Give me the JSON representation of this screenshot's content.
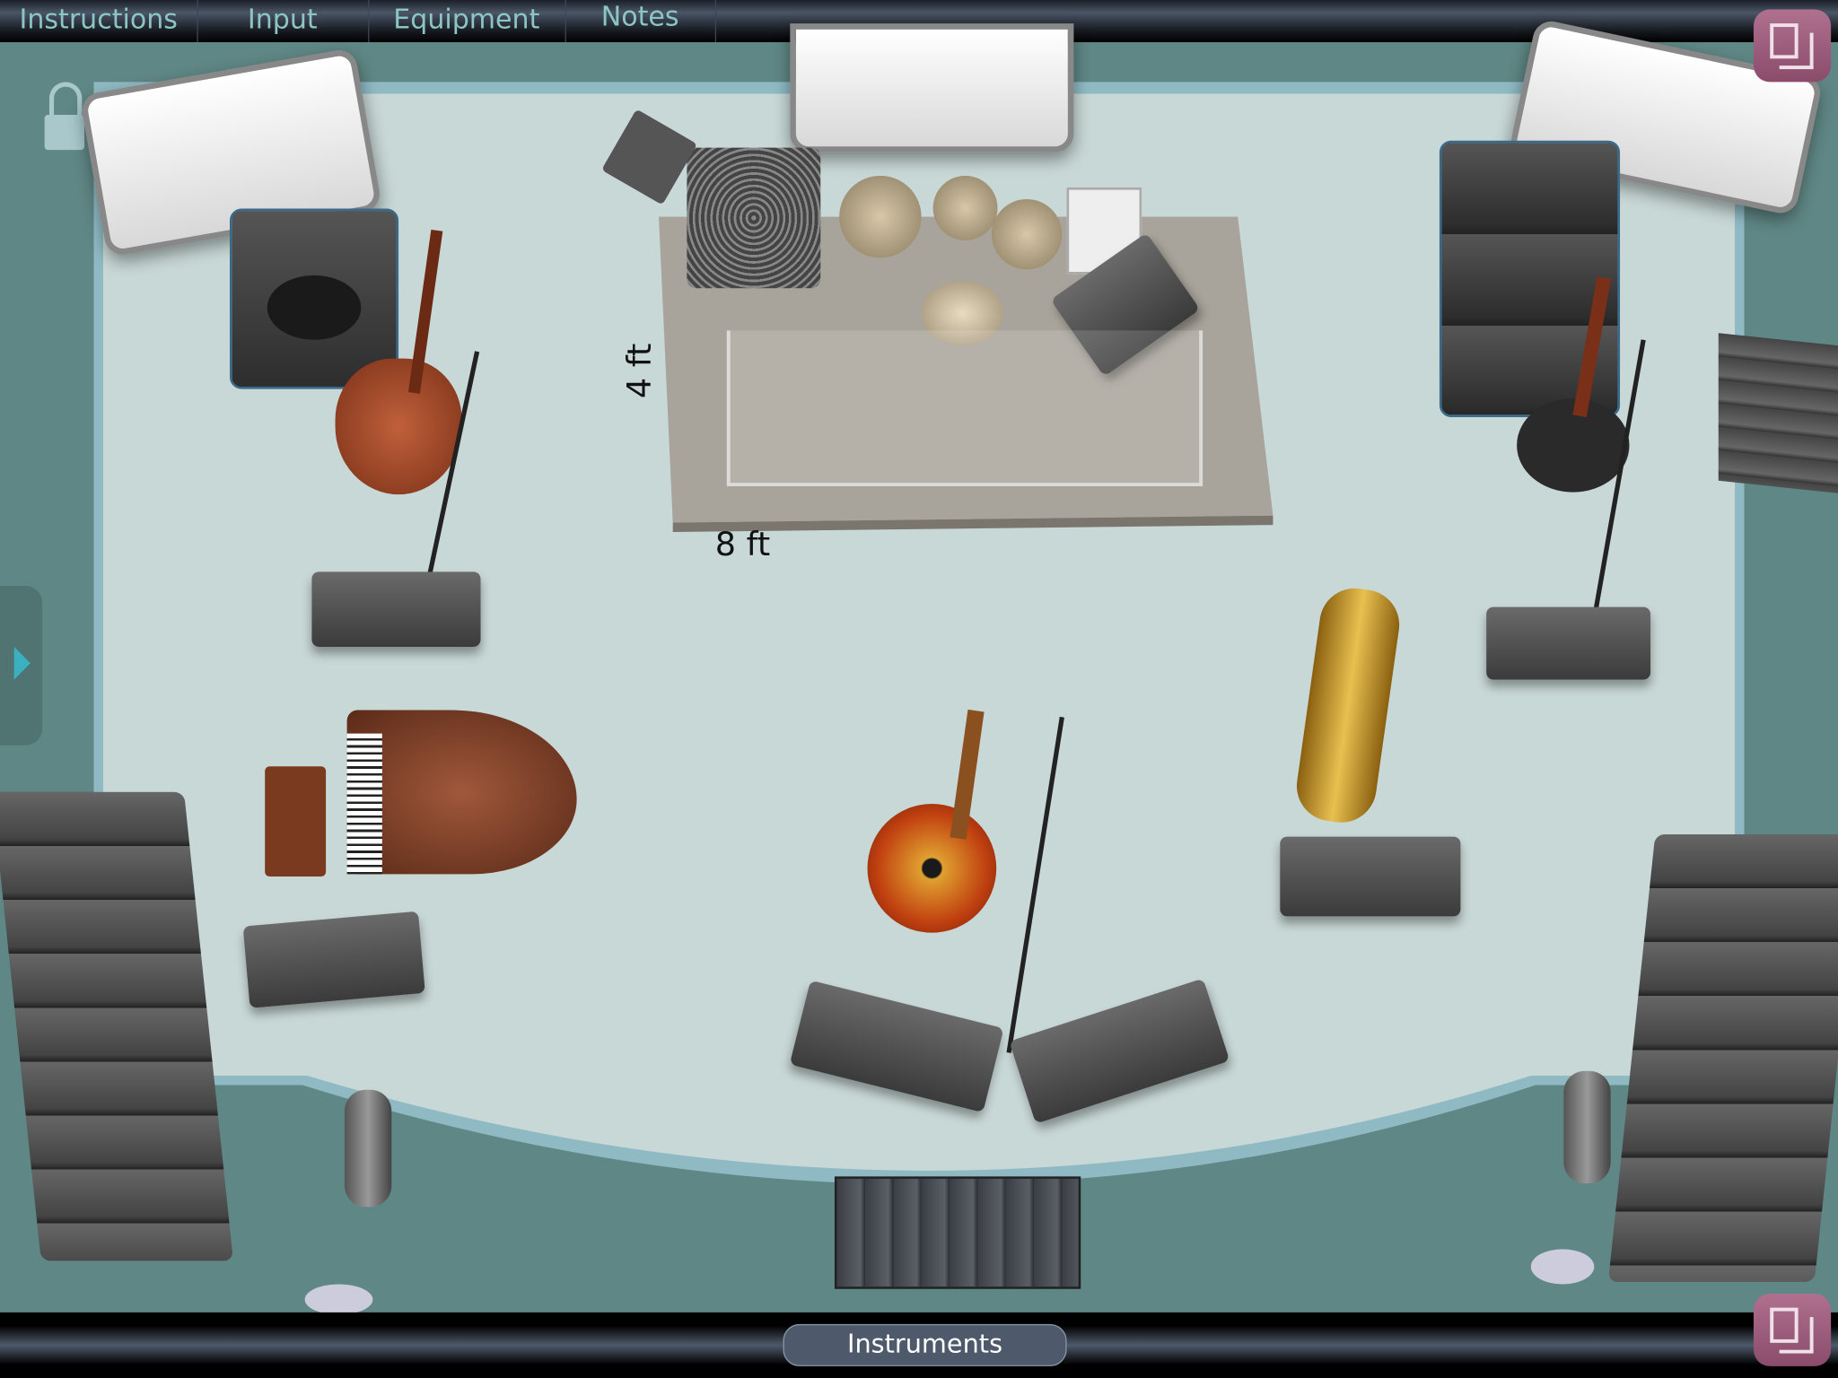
{
  "top_tabs": [
    {
      "label": "Instructions"
    },
    {
      "label": "Input"
    },
    {
      "label": "Equipment"
    },
    {
      "label": "Notes"
    }
  ],
  "stage": {
    "riser_width_label": "8 ft",
    "riser_depth_label": "4 ft"
  },
  "bottom": {
    "instruments_label": "Instruments"
  },
  "colors": {
    "tab_text": "#8cc6c4",
    "stage_floor": "#c8d8d6",
    "surround": "#5f8785",
    "accent_button": "#a06080"
  },
  "icons": [
    "lock-icon",
    "resize-icon",
    "expand-arrow-icon"
  ]
}
